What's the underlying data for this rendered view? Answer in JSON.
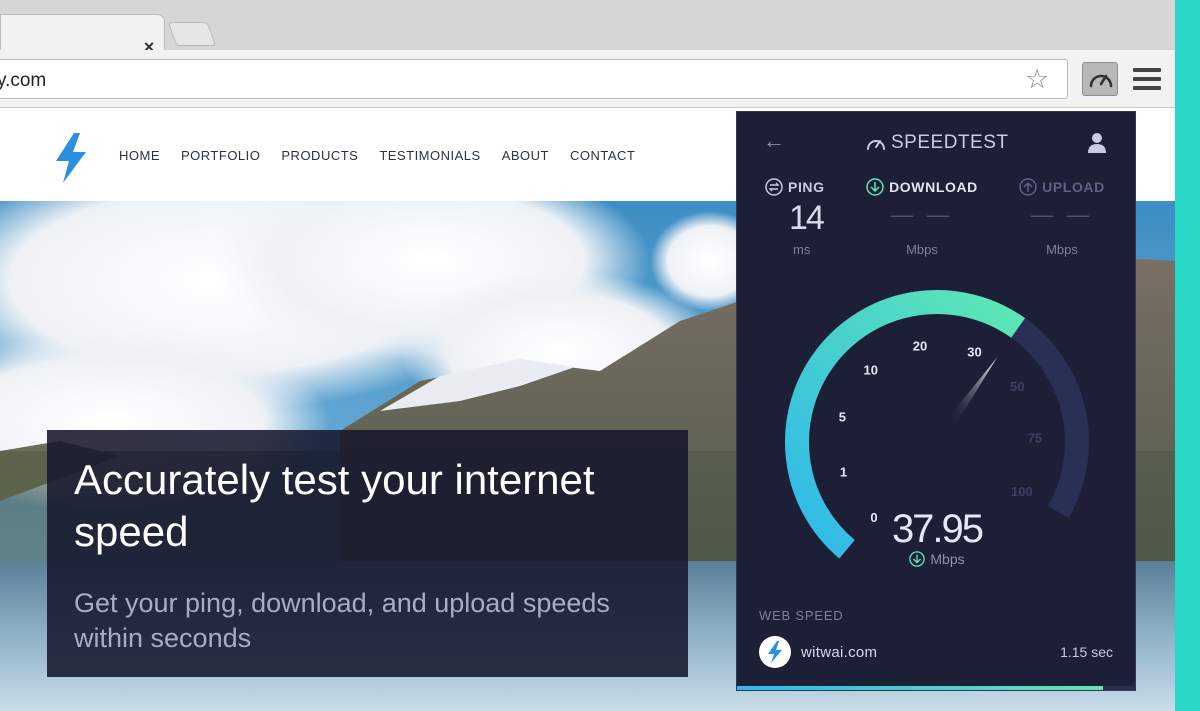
{
  "browser": {
    "tab_close_glyph": "×",
    "url": "y.com",
    "star_glyph": "☆"
  },
  "site": {
    "nav": [
      "HOME",
      "PORTFOLIO",
      "PRODUCTS",
      "TESTIMONIALS",
      "ABOUT",
      "CONTACT"
    ],
    "hero_title": "Accurately test your internet speed",
    "hero_subtitle": "Get your ping, download, and upload speeds within seconds",
    "brand_color": "#2a8fe0"
  },
  "speedtest": {
    "brand": "SPEEDTEST",
    "back_glyph": "←",
    "ping": {
      "label": "PING",
      "value": "14",
      "unit": "ms"
    },
    "download": {
      "label": "DOWNLOAD",
      "value": "— —",
      "unit": "Mbps"
    },
    "upload": {
      "label": "UPLOAD",
      "value": "— —",
      "unit": "Mbps"
    },
    "gauge": {
      "ticks": [
        "0",
        "1",
        "5",
        "10",
        "20",
        "30",
        "50",
        "75",
        "100"
      ],
      "active_ticks": 6,
      "needle_value": 37.95
    },
    "speed": {
      "value": "37.95",
      "unit": "Mbps"
    },
    "web_speed": {
      "title": "WEB SPEED",
      "site": "witwai.com",
      "time": "1.15 sec",
      "progress": 0.92
    },
    "colors": {
      "accent_teal": "#5ee8b3",
      "accent_blue": "#2fb8ea",
      "panel": "#1c1f36"
    }
  }
}
